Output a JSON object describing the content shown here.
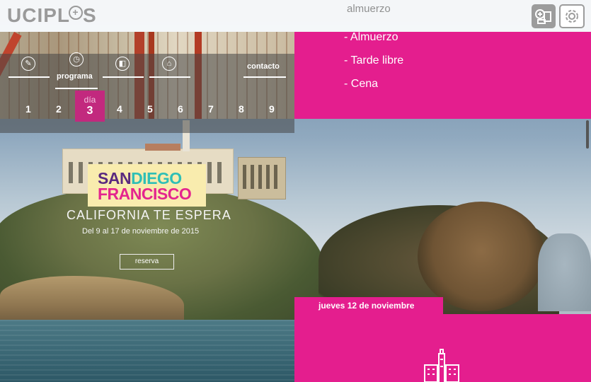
{
  "header": {
    "logo": "UCIPL",
    "logo_tail": "S",
    "faded_title": "almuerzo",
    "add_button_icon": "add-card-icon",
    "settings_button_icon": "settings-icon"
  },
  "nav": {
    "items": [
      {
        "label": "",
        "icon": "pencil-icon"
      },
      {
        "label": "programa",
        "icon": "clock-icon"
      },
      {
        "label": "",
        "icon": "hotel-icon"
      },
      {
        "label": "",
        "icon": "home-icon"
      },
      {
        "label": "contacto",
        "icon": ""
      }
    ],
    "day_label": "día",
    "active_day": "3",
    "days": [
      "1",
      "2",
      "4",
      "5",
      "6",
      "7",
      "8",
      "9"
    ]
  },
  "program": {
    "items": [
      "- Almuerzo",
      "- Tarde libre",
      "- Cena"
    ]
  },
  "hero": {
    "sign_line1_a": "SAN",
    "sign_line1_b": "DIEGO",
    "sign_line2": "FRANCISCO",
    "tagline": "CALIFORNIA TE ESPERA",
    "dates": "Del 9 al 17 de noviembre de 2015",
    "reserve_button": "reserva"
  },
  "day_panel": {
    "date_label": "jueves 12 de noviembre",
    "icon": "landmark-building-icon"
  },
  "colors": {
    "accent": "#e41e8e",
    "active_day": "#c2297e",
    "sign_bg": "#f9ecae"
  }
}
